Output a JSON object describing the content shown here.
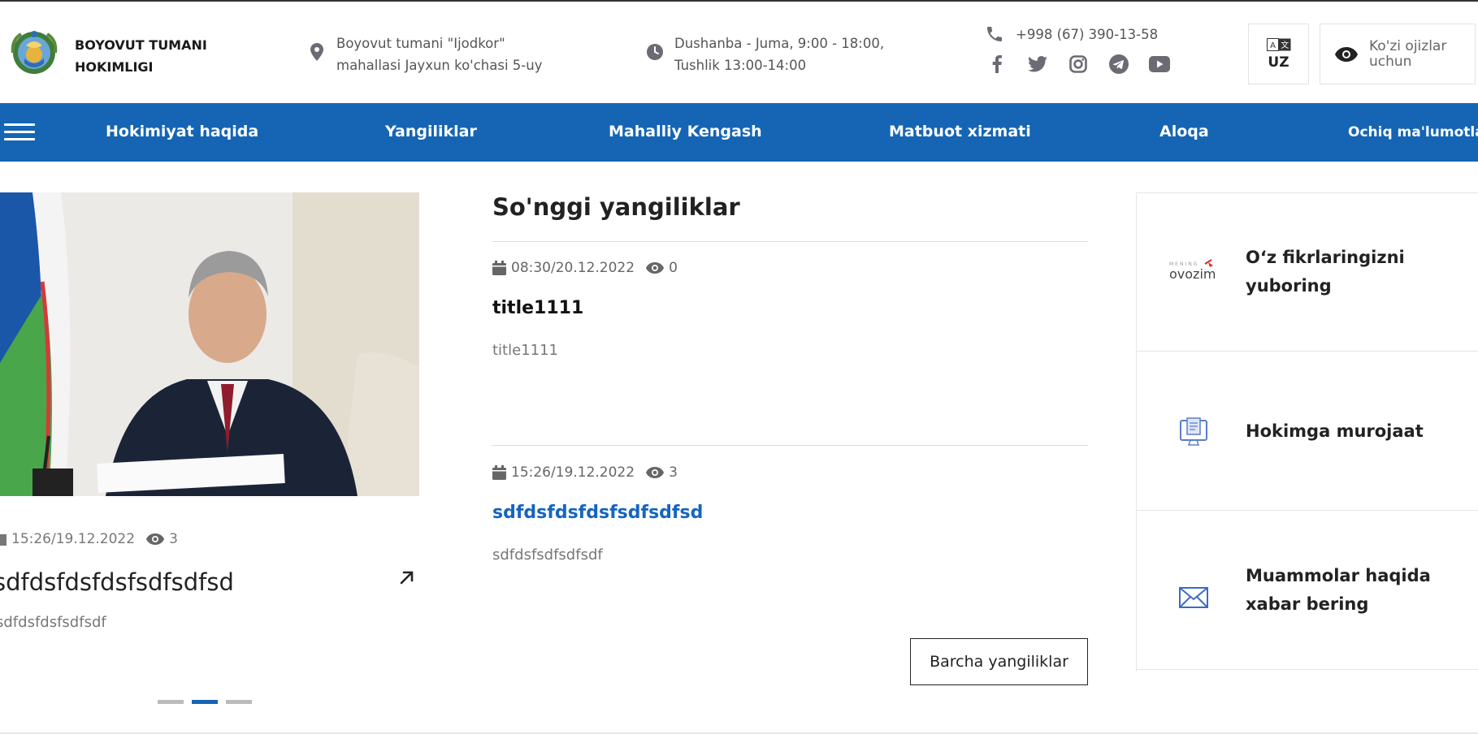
{
  "header": {
    "brand": {
      "line1": "BOYOVUT TUMANI",
      "line2": "HOKIMLIGI"
    },
    "address": {
      "line1": "Boyovut tumani \"Ijodkor\"",
      "line2": "mahallasi Jayxun ko'chasi 5-uy"
    },
    "hours": {
      "line1": "Dushanba - Juma, 9:00 - 18:00,",
      "line2": "Tushlik 13:00-14:00"
    },
    "phone": "+998 (67) 390-13-58",
    "socials": [
      "facebook-icon",
      "twitter-icon",
      "instagram-icon",
      "telegram-icon",
      "youtube-icon"
    ],
    "language": "UZ",
    "accessibility": "Ko'zi ojizlar uchun"
  },
  "nav": {
    "items": [
      "Hokimiyat haqida",
      "Yangiliklar",
      "Mahalliy Kengash",
      "Matbuot xizmati",
      "Aloqa",
      "Ochiq ma'lumotlar"
    ]
  },
  "featured": {
    "meta": {
      "datetime": "15:26/19.12.2022",
      "views": "3"
    },
    "title": "sdfdsfdsfdsfsdfsdfsd",
    "description": "sdfdsfdsfsdfsdf",
    "slides_total": 3,
    "active_slide": 2
  },
  "latest": {
    "title": "So'nggi yangiliklar",
    "items": [
      {
        "datetime": "08:30/20.12.2022",
        "views": "0",
        "title": "title1111",
        "description": "title1111"
      },
      {
        "datetime": "15:26/19.12.2022",
        "views": "3",
        "title": "sdfdsfdsfdsfsdfsdfsd",
        "description": "sdfdsfsdfsdfsdf"
      }
    ],
    "all_button": "Barcha yangiliklar"
  },
  "cards": [
    {
      "logo_text": "ovozim",
      "label": "O‘z fikrlaringizni yuboring"
    },
    {
      "label": "Hokimga murojaat"
    },
    {
      "label": "Muammolar haqida xabar bering"
    }
  ],
  "colors": {
    "primary": "#1565b4",
    "link": "#1565c0"
  }
}
